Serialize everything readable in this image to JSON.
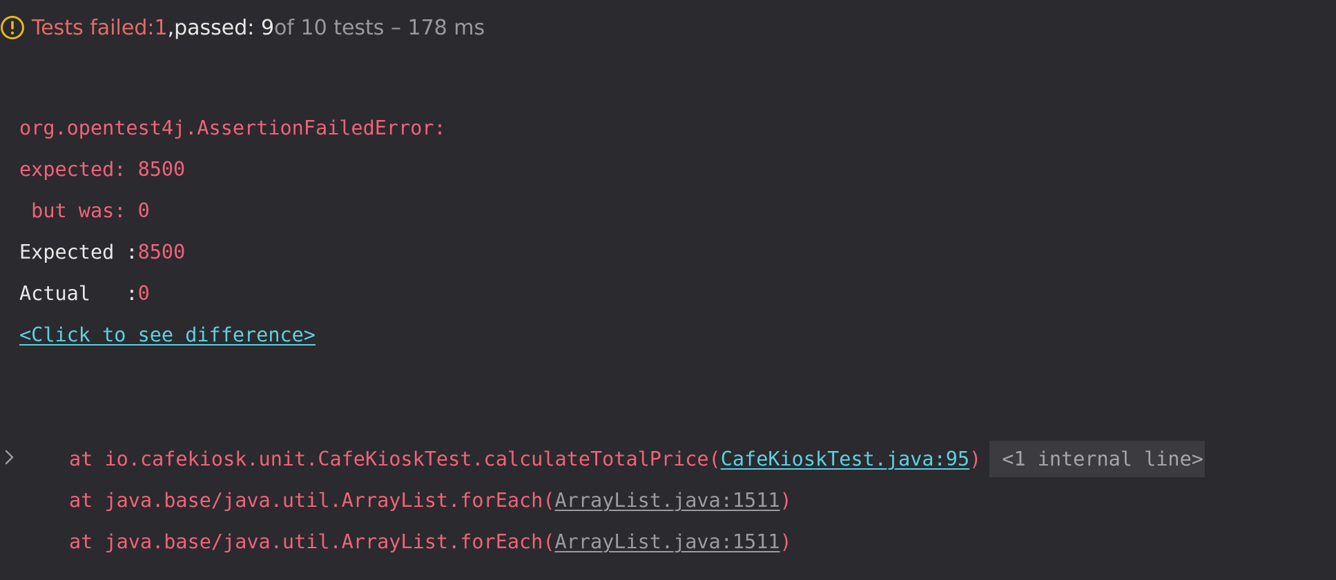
{
  "summary": {
    "failed_label": "Tests failed: ",
    "failed_count": "1",
    "separator": ", ",
    "passed_label": "passed: 9",
    "rest": " of 10 tests – 178 ms"
  },
  "error": {
    "exception": "org.opentest4j.AssertionFailedError:",
    "expected_line": "expected: 8500",
    "but_was_line": " but was: 0",
    "expected_label": "Expected :",
    "expected_value": "8500",
    "actual_label": "Actual   :",
    "actual_value": "0",
    "diff_link": "<Click to see difference>"
  },
  "stack": [
    {
      "prefix": "at io.cafekiosk.unit.CafeKioskTest.calculateTotalPrice(",
      "link": "CafeKioskTest.java:95",
      "suffix": ")",
      "internal": "<1 internal line>"
    },
    {
      "prefix": "at java.base/java.util.ArrayList.forEach(",
      "link": "ArrayList.java:1511",
      "suffix": ")"
    },
    {
      "prefix": "at java.base/java.util.ArrayList.forEach(",
      "link": "ArrayList.java:1511",
      "suffix": ")"
    }
  ],
  "colors": {
    "background": "#2b2a2e",
    "error_text": "#f0637a",
    "link": "#5fd0e0",
    "warning_icon": "#e8b71b"
  },
  "icons": {
    "status": "warning-circle-icon",
    "expand": "chevron-right-icon"
  }
}
